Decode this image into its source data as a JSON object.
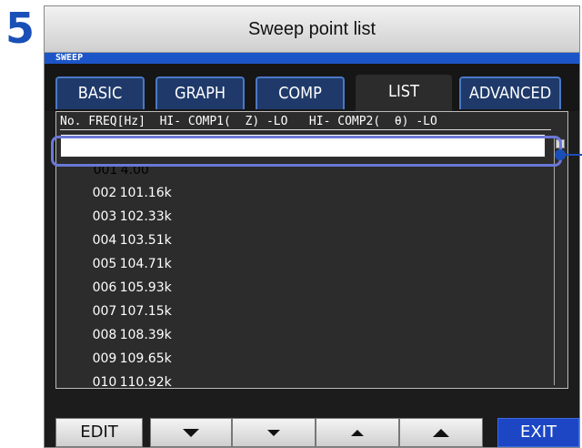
{
  "step_number": "5",
  "window": {
    "title": "Sweep point list",
    "mode": "SWEEP"
  },
  "tabs": [
    {
      "label": "BASIC",
      "active": false
    },
    {
      "label": "GRAPH",
      "active": false
    },
    {
      "label": "COMP",
      "active": false
    },
    {
      "label": "LIST",
      "active": true
    },
    {
      "label": "ADVANCED",
      "active": false
    }
  ],
  "list": {
    "header": "No. FREQ[Hz]  HI- COMP1(  Z) -LO   HI- COMP2(  θ) -LO",
    "rows": [
      {
        "no": "001",
        "freq": "4.00",
        "selected": true
      },
      {
        "no": "002",
        "freq": "101.16k",
        "selected": false
      },
      {
        "no": "003",
        "freq": "102.33k",
        "selected": false
      },
      {
        "no": "004",
        "freq": "103.51k",
        "selected": false
      },
      {
        "no": "005",
        "freq": "104.71k",
        "selected": false
      },
      {
        "no": "006",
        "freq": "105.93k",
        "selected": false
      },
      {
        "no": "007",
        "freq": "107.15k",
        "selected": false
      },
      {
        "no": "008",
        "freq": "108.39k",
        "selected": false
      },
      {
        "no": "009",
        "freq": "109.65k",
        "selected": false
      },
      {
        "no": "010",
        "freq": "110.92k",
        "selected": false
      }
    ]
  },
  "footer": {
    "edit_label": "EDIT",
    "exit_label": "EXIT",
    "nav_icons": [
      "page-down-icon",
      "row-down-icon",
      "row-up-icon",
      "page-up-icon"
    ]
  },
  "colors": {
    "accent_blue": "#1c55c8",
    "callout_blue": "#1a4fb8",
    "highlight_outline": "#6b78d6",
    "screen_bg": "#1c1c1c"
  }
}
